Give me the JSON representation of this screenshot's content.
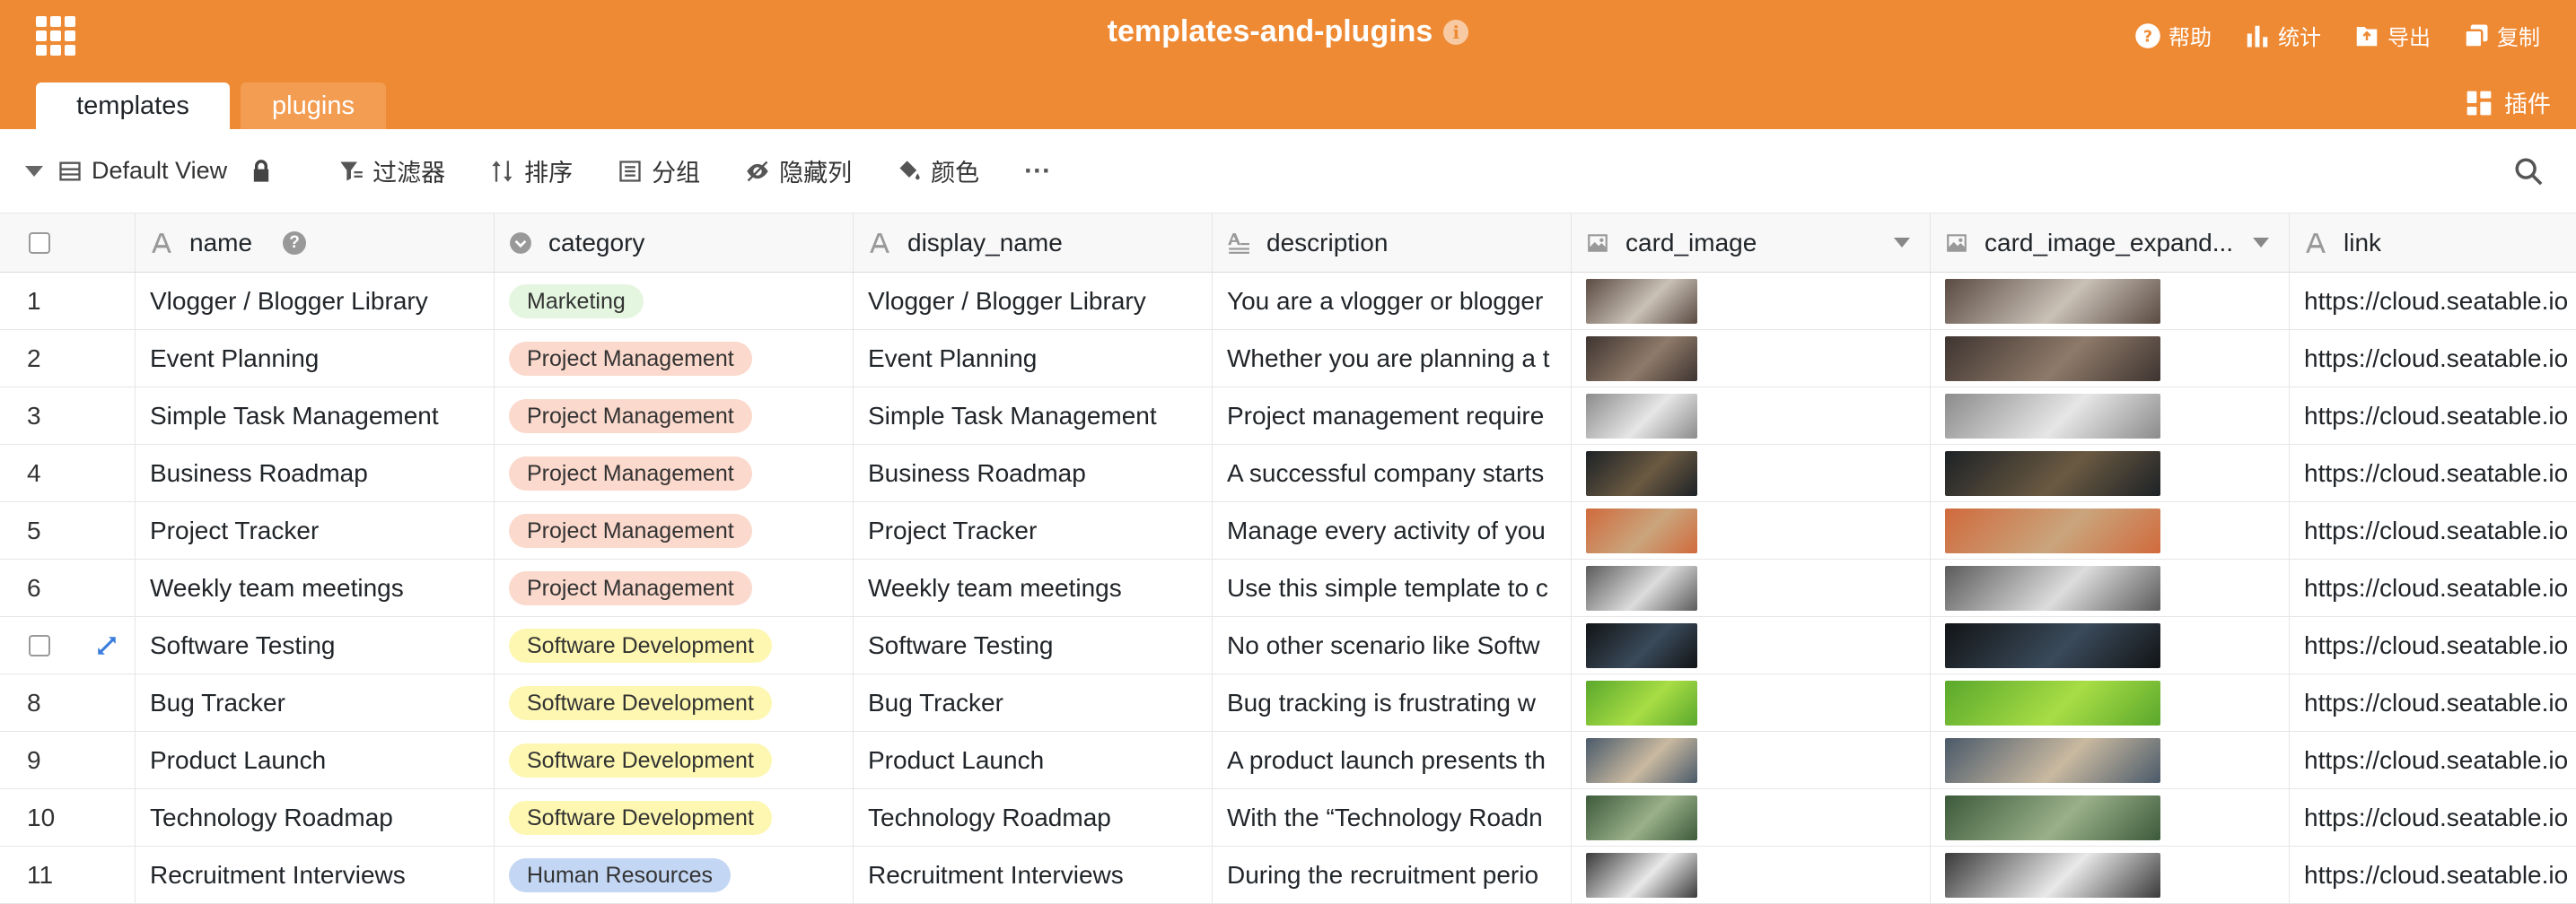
{
  "header": {
    "title": "templates-and-plugins",
    "actions": [
      {
        "label": "帮助",
        "icon": "help-circle-icon"
      },
      {
        "label": "统计",
        "icon": "bar-chart-icon"
      },
      {
        "label": "导出",
        "icon": "export-icon"
      },
      {
        "label": "复制",
        "icon": "copy-icon"
      }
    ],
    "tabs": [
      {
        "label": "templates",
        "active": true
      },
      {
        "label": "plugins",
        "active": false
      }
    ],
    "plugins_label": "插件",
    "brand_color": "#ef8a34"
  },
  "toolbar": {
    "view_name": "Default View",
    "filter": "过滤器",
    "sort": "排序",
    "group": "分组",
    "hide_columns": "隐藏列",
    "color": "颜色",
    "more": "···"
  },
  "columns": [
    {
      "key": "name",
      "label": "name",
      "icon": "text-type-icon"
    },
    {
      "key": "category",
      "label": "category",
      "icon": "single-select-icon"
    },
    {
      "key": "display_name",
      "label": "display_name",
      "icon": "text-type-icon"
    },
    {
      "key": "description",
      "label": "description",
      "icon": "long-text-icon"
    },
    {
      "key": "card_image",
      "label": "card_image",
      "icon": "image-icon"
    },
    {
      "key": "card_image_expanded",
      "label": "card_image_expand...",
      "icon": "image-icon"
    },
    {
      "key": "link",
      "label": "link",
      "icon": "text-type-icon"
    }
  ],
  "category_colors": {
    "Marketing": "#e5f6e0",
    "Project Management": "#fbd9cc",
    "Software Development": "#fdf7b1",
    "Human Resources": "#c3d6f4"
  },
  "rows": [
    {
      "num": "1",
      "name": "Vlogger / Blogger Library",
      "category": "Marketing",
      "display_name": "Vlogger / Blogger Library",
      "description": "You are a vlogger or blogger",
      "link": "https://cloud.seatable.io",
      "img": [
        "#5a4a42",
        "#c9c0b6"
      ]
    },
    {
      "num": "2",
      "name": "Event Planning",
      "category": "Project Management",
      "display_name": "Event Planning",
      "description": "Whether you are planning a t",
      "link": "https://cloud.seatable.io",
      "img": [
        "#3e3430",
        "#8e7a6a"
      ]
    },
    {
      "num": "3",
      "name": "Simple Task Management",
      "category": "Project Management",
      "display_name": "Simple Task Management",
      "description": "Project management require",
      "link": "https://cloud.seatable.io",
      "img": [
        "#8b8b8b",
        "#e6e6e6"
      ]
    },
    {
      "num": "4",
      "name": "Business Roadmap",
      "category": "Project Management",
      "display_name": "Business Roadmap",
      "description": "A successful company starts",
      "link": "https://cloud.seatable.io",
      "img": [
        "#1d2226",
        "#6b5a42"
      ]
    },
    {
      "num": "5",
      "name": "Project Tracker",
      "category": "Project Management",
      "display_name": "Project Tracker",
      "description": "Manage every activity of you",
      "link": "https://cloud.seatable.io",
      "img": [
        "#d06a3c",
        "#caa57d"
      ]
    },
    {
      "num": "6",
      "name": "Weekly team meetings",
      "category": "Project Management",
      "display_name": "Weekly team meetings",
      "description": "Use this simple template to c",
      "link": "https://cloud.seatable.io",
      "img": [
        "#5b5b5b",
        "#dcdcdc"
      ]
    },
    {
      "num": "",
      "name": "Software Testing",
      "category": "Software Development",
      "display_name": "Software Testing",
      "description": "No other scenario like Softw",
      "link": "https://cloud.seatable.io",
      "img": [
        "#121416",
        "#3a4a5a"
      ],
      "hover": true
    },
    {
      "num": "8",
      "name": "Bug Tracker",
      "category": "Software Development",
      "display_name": "Bug Tracker",
      "description": "Bug tracking is frustrating w",
      "link": "https://cloud.seatable.io",
      "img": [
        "#5aa82c",
        "#a8dd45"
      ]
    },
    {
      "num": "9",
      "name": "Product Launch",
      "category": "Software Development",
      "display_name": "Product Launch",
      "description": "A product launch presents th",
      "link": "https://cloud.seatable.io",
      "img": [
        "#4a5a6a",
        "#c9b9a0"
      ]
    },
    {
      "num": "10",
      "name": "Technology Roadmap",
      "category": "Software Development",
      "display_name": "Technology Roadmap",
      "description": "With the “Technology Roadn",
      "link": "https://cloud.seatable.io",
      "img": [
        "#3c5a3a",
        "#9ab08a"
      ]
    },
    {
      "num": "11",
      "name": "Recruitment Interviews",
      "category": "Human Resources",
      "display_name": "Recruitment Interviews",
      "description": "During the recruitment perio",
      "link": "https://cloud.seatable.io",
      "img": [
        "#3a3a3a",
        "#e9e9e9"
      ]
    }
  ]
}
